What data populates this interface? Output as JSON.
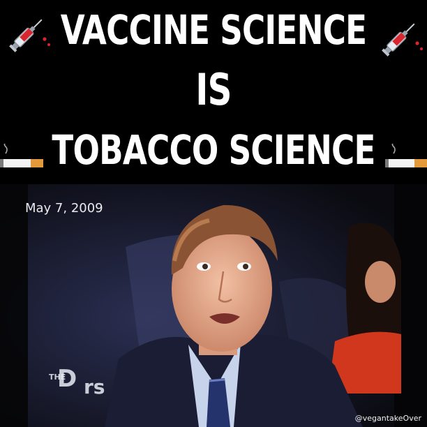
{
  "headline": {
    "line1": "VACCINE SCIENCE",
    "line2": "IS",
    "line3": "TOBACCO SCIENCE"
  },
  "decorations": {
    "top_icons": [
      "syringe-icon",
      "syringe-icon"
    ],
    "bottom_icons": [
      "cigarette-icon",
      "cigarette-icon"
    ]
  },
  "video": {
    "date": "May 7, 2009",
    "show_logo": "THE DRs",
    "watermark": "@vegantakeOver"
  }
}
